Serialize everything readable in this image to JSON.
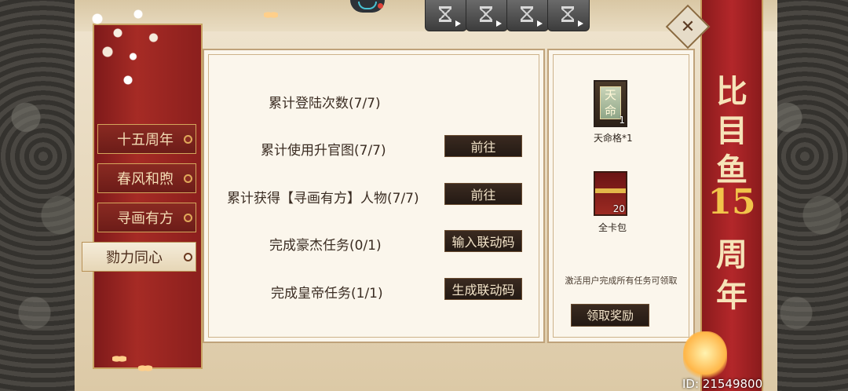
{
  "tabs": [
    {
      "label": "十五周年",
      "active": false
    },
    {
      "label": "春风和煦",
      "active": false
    },
    {
      "label": "寻画有方",
      "active": false
    },
    {
      "label": "勠力同心",
      "active": true
    }
  ],
  "tasks": [
    {
      "label": "累计登陆次数(7/7)",
      "button": null
    },
    {
      "label": "累计使用升官图(7/7)",
      "button": "前往"
    },
    {
      "label": "累计获得【寻画有方】人物(7/7)",
      "button": "前往"
    },
    {
      "label": "完成豪杰任务(0/1)",
      "button": "输入联动码"
    },
    {
      "label": "完成皇帝任务(1/1)",
      "button": "生成联动码"
    }
  ],
  "rewards": [
    {
      "name": "天命格*1",
      "plate_text": "天命",
      "count": "1",
      "icon": "tianming-plate-icon"
    },
    {
      "name": "全卡包",
      "count": "20",
      "icon": "card-pack-icon"
    }
  ],
  "reward_note": "激活用户完成所有任务可领取",
  "claim_button": "领取奖励",
  "event_title": {
    "line1": "比",
    "line2": "目",
    "line3": "鱼",
    "num": "15",
    "line4": "周",
    "line5": "年"
  },
  "user_id": "ID: 21549800",
  "colors": {
    "banner_red": "#a62b25",
    "button_dark": "#2a1e17",
    "gold": "#d4a65c",
    "paper": "#fbf6ec"
  }
}
